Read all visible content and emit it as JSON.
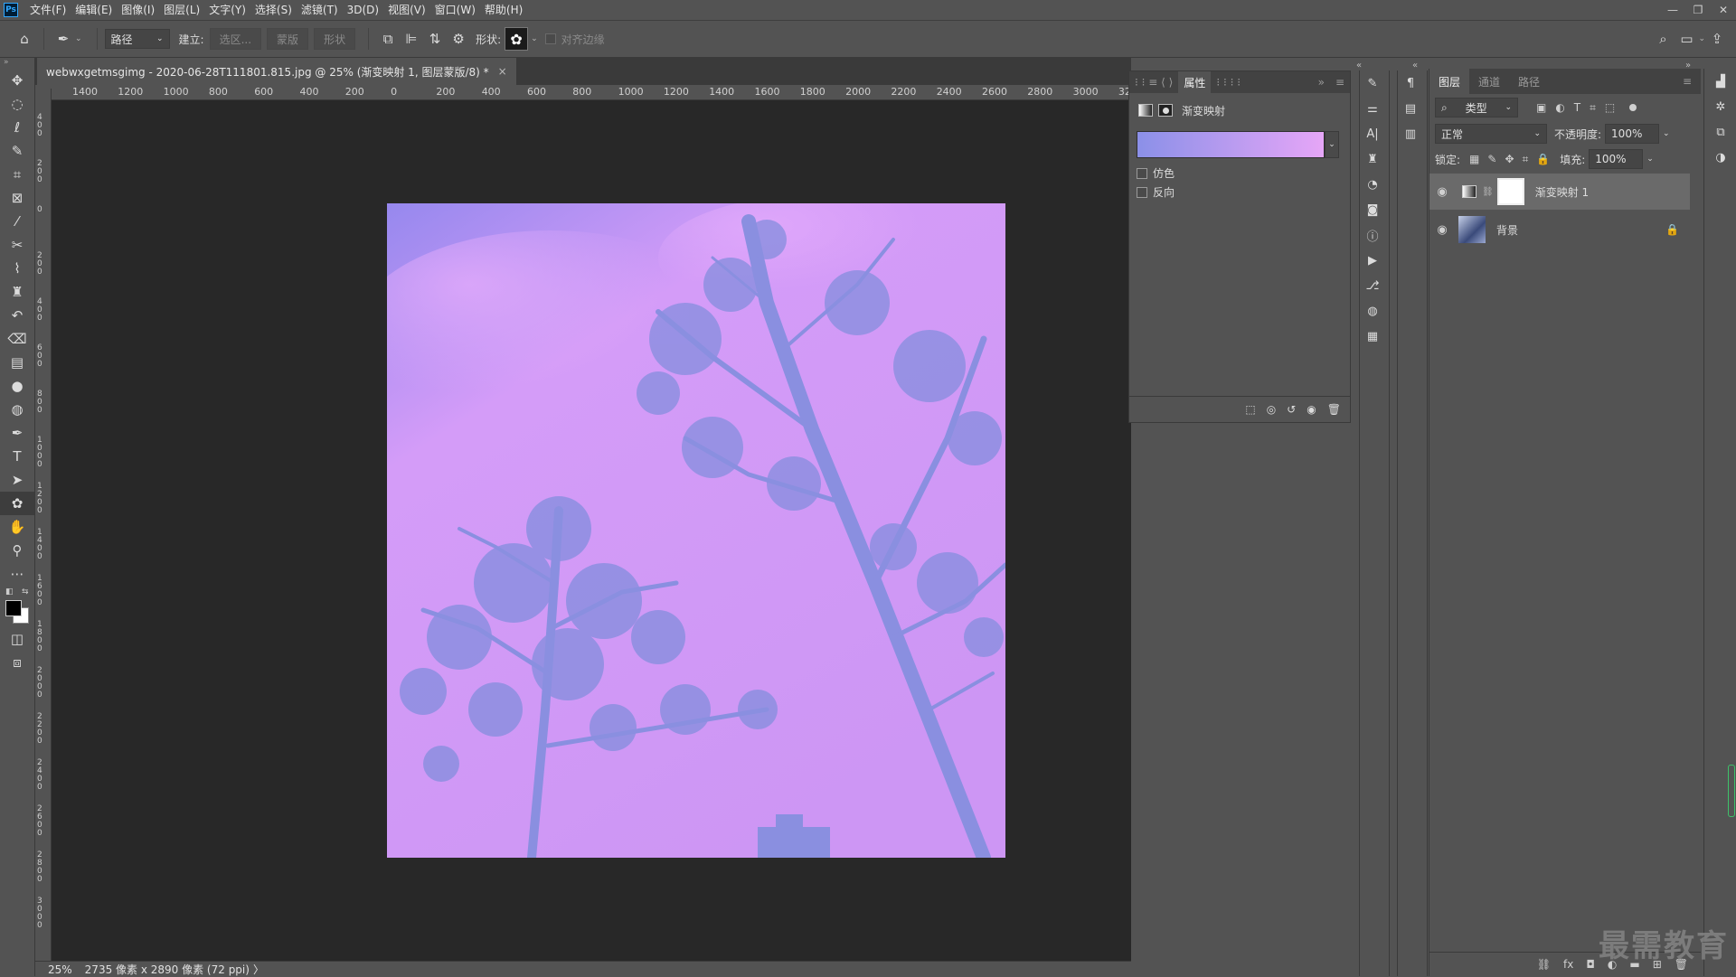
{
  "app": {
    "logo": "Ps"
  },
  "menu": [
    "文件(F)",
    "编辑(E)",
    "图像(I)",
    "图层(L)",
    "文字(Y)",
    "选择(S)",
    "滤镜(T)",
    "3D(D)",
    "视图(V)",
    "窗口(W)",
    "帮助(H)"
  ],
  "options": {
    "mode": "路径",
    "make_label": "建立:",
    "selection_btn": "选区...",
    "mask_btn": "蒙版",
    "shape_btn": "形状",
    "shape_label": "形状:",
    "align_edges": "对齐边缘"
  },
  "document": {
    "tab_title": "webwxgetmsgimg - 2020-06-28T111801.815.jpg @ 25% (渐变映射 1, 图层蒙版/8) *",
    "close": "×"
  },
  "ruler": {
    "h_ticks": [
      "1400",
      "1200",
      "1000",
      "800",
      "600",
      "400",
      "200",
      "0",
      "200",
      "400",
      "600",
      "800",
      "1000",
      "1200",
      "1400",
      "1600",
      "1800",
      "2000",
      "2200",
      "2400",
      "2600",
      "2800",
      "3000",
      "32"
    ],
    "v_ticks": [
      "400",
      "200",
      "0",
      "200",
      "400",
      "600",
      "800",
      "1000",
      "1200",
      "1400",
      "1600",
      "1800",
      "2000",
      "2200",
      "2400",
      "2600",
      "2800",
      "3000"
    ]
  },
  "status": {
    "zoom": "25%",
    "info": "2735 像素 x 2890 像素 (72 ppi)",
    "arrow": "〉"
  },
  "properties": {
    "tab_label": "属性",
    "adjustment_title": "渐变映射",
    "dither": "仿色",
    "reverse": "反向",
    "gradient_start": "#8b90e8",
    "gradient_end": "#e6a6f7"
  },
  "layers": {
    "tabs": [
      "图层",
      "通道",
      "路径"
    ],
    "filter_kind": "类型",
    "blend_mode": "正常",
    "opacity_label": "不透明度:",
    "opacity": "100%",
    "lock_label": "锁定:",
    "fill_label": "填充:",
    "fill": "100%",
    "items": [
      {
        "name": "渐变映射 1"
      },
      {
        "name": "背景"
      }
    ]
  },
  "watermark": "最需教育",
  "colors": {
    "canvas_bg": "#282828",
    "panel_bg": "#535353",
    "sky_top": "#9a8cf0",
    "sky_mid": "#d59ef8",
    "tree": "#8a8fe0"
  }
}
